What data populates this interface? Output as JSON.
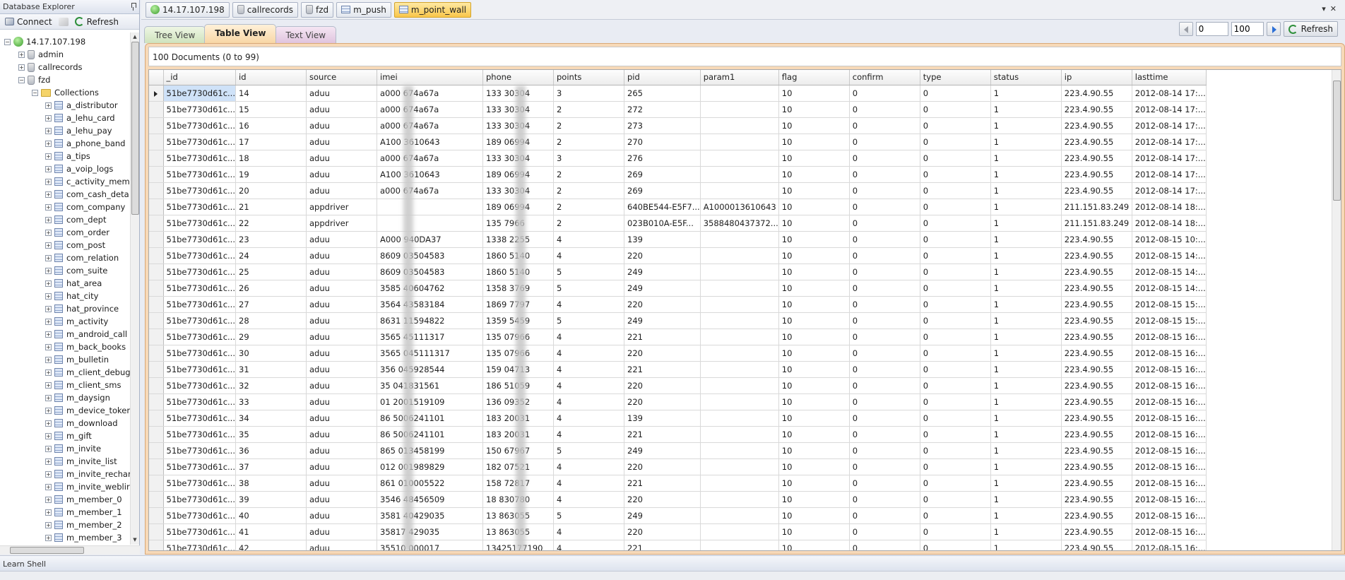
{
  "sidebar": {
    "title": "Database Explorer",
    "connect_label": "Connect",
    "refresh_label": "Refresh",
    "server": "14.17.107.198",
    "databases": [
      "admin",
      "callrecords",
      "fzd"
    ],
    "collections_label": "Collections",
    "collections": [
      "a_distributor",
      "a_lehu_card",
      "a_lehu_pay",
      "a_phone_band",
      "a_tips",
      "a_voip_logs",
      "c_activity_mem",
      "com_cash_deta",
      "com_company",
      "com_dept",
      "com_order",
      "com_post",
      "com_relation",
      "com_suite",
      "hat_area",
      "hat_city",
      "hat_province",
      "m_activity",
      "m_android_call",
      "m_back_books",
      "m_bulletin",
      "m_client_debug",
      "m_client_sms",
      "m_daysign",
      "m_device_toker",
      "m_download",
      "m_gift",
      "m_invite",
      "m_invite_list",
      "m_invite_rechar",
      "m_invite_weblir",
      "m_member_0",
      "m_member_1",
      "m_member_2",
      "m_member_3"
    ]
  },
  "doc_tabs": [
    "14.17.107.198",
    "callrecords",
    "fzd",
    "m_push",
    "m_point_wall"
  ],
  "view_tabs": [
    "Tree View",
    "Table View",
    "Text View"
  ],
  "pager": {
    "from": "0",
    "to": "100",
    "refresh_label": "Refresh"
  },
  "doc_count": "100 Documents (0 to 99)",
  "columns": [
    "_id",
    "id",
    "source",
    "imei",
    "phone",
    "points",
    "pid",
    "param1",
    "flag",
    "confirm",
    "type",
    "status",
    "ip",
    "lasttime"
  ],
  "rows": [
    [
      "51be7730d61c...",
      "14",
      "aduu",
      "a000    674a67a",
      "133    30304",
      "3",
      "265",
      "",
      "10",
      "0",
      "0",
      "1",
      "223.4.90.55",
      "2012-08-14 17:..."
    ],
    [
      "51be7730d61c...",
      "15",
      "aduu",
      "a000    674a67a",
      "133    30304",
      "2",
      "272",
      "",
      "10",
      "0",
      "0",
      "1",
      "223.4.90.55",
      "2012-08-14 17:..."
    ],
    [
      "51be7730d61c...",
      "16",
      "aduu",
      "a000    674a67a",
      "133    30304",
      "2",
      "273",
      "",
      "10",
      "0",
      "0",
      "1",
      "223.4.90.55",
      "2012-08-14 17:..."
    ],
    [
      "51be7730d61c...",
      "17",
      "aduu",
      "A100    3610643",
      "189    06994",
      "2",
      "270",
      "",
      "10",
      "0",
      "0",
      "1",
      "223.4.90.55",
      "2012-08-14 17:..."
    ],
    [
      "51be7730d61c...",
      "18",
      "aduu",
      "a000    674a67a",
      "133    30304",
      "3",
      "276",
      "",
      "10",
      "0",
      "0",
      "1",
      "223.4.90.55",
      "2012-08-14 17:..."
    ],
    [
      "51be7730d61c...",
      "19",
      "aduu",
      "A100    3610643",
      "189    06994",
      "2",
      "269",
      "",
      "10",
      "0",
      "0",
      "1",
      "223.4.90.55",
      "2012-08-14 17:..."
    ],
    [
      "51be7730d61c...",
      "20",
      "aduu",
      "a000    674a67a",
      "133    30304",
      "2",
      "269",
      "",
      "10",
      "0",
      "0",
      "1",
      "223.4.90.55",
      "2012-08-14 17:..."
    ],
    [
      "51be7730d61c...",
      "21",
      "appdriver",
      "",
      "189    06994",
      "2",
      "640BE544-E5F7...",
      "A1000013610643",
      "10",
      "0",
      "0",
      "1",
      "211.151.83.249",
      "2012-08-14 18:..."
    ],
    [
      "51be7730d61c...",
      "22",
      "appdriver",
      "",
      "135    7966",
      "2",
      "023B010A-E5F...",
      "3588480437372...",
      "10",
      "0",
      "0",
      "1",
      "211.151.83.249",
      "2012-08-14 18:..."
    ],
    [
      "51be7730d61c...",
      "23",
      "aduu",
      "A000    940DA37",
      "1338    2255",
      "4",
      "139",
      "",
      "10",
      "0",
      "0",
      "1",
      "223.4.90.55",
      "2012-08-15 10:..."
    ],
    [
      "51be7730d61c...",
      "24",
      "aduu",
      "8609    03504583",
      "1860    5140",
      "4",
      "220",
      "",
      "10",
      "0",
      "0",
      "1",
      "223.4.90.55",
      "2012-08-15 14:..."
    ],
    [
      "51be7730d61c...",
      "25",
      "aduu",
      "8609    03504583",
      "1860    5140",
      "5",
      "249",
      "",
      "10",
      "0",
      "0",
      "1",
      "223.4.90.55",
      "2012-08-15 14:..."
    ],
    [
      "51be7730d61c...",
      "26",
      "aduu",
      "3585    40604762",
      "1358    3769",
      "5",
      "249",
      "",
      "10",
      "0",
      "0",
      "1",
      "223.4.90.55",
      "2012-08-15 14:..."
    ],
    [
      "51be7730d61c...",
      "27",
      "aduu",
      "3564    43583184",
      "1869    7797",
      "4",
      "220",
      "",
      "10",
      "0",
      "0",
      "1",
      "223.4.90.55",
      "2012-08-15 15:..."
    ],
    [
      "51be7730d61c...",
      "28",
      "aduu",
      "8631    11594822",
      "1359    5459",
      "5",
      "249",
      "",
      "10",
      "0",
      "0",
      "1",
      "223.4.90.55",
      "2012-08-15 15:..."
    ],
    [
      "51be7730d61c...",
      "29",
      "aduu",
      "3565    45111317",
      "135    07966",
      "4",
      "221",
      "",
      "10",
      "0",
      "0",
      "1",
      "223.4.90.55",
      "2012-08-15 16:..."
    ],
    [
      "51be7730d61c...",
      "30",
      "aduu",
      "3565    045111317",
      "135    07966",
      "4",
      "220",
      "",
      "10",
      "0",
      "0",
      "1",
      "223.4.90.55",
      "2012-08-15 16:..."
    ],
    [
      "51be7730d61c...",
      "31",
      "aduu",
      "356    045928544",
      "159    04713",
      "4",
      "221",
      "",
      "10",
      "0",
      "0",
      "1",
      "223.4.90.55",
      "2012-08-15 16:..."
    ],
    [
      "51be7730d61c...",
      "32",
      "aduu",
      "35    041831561",
      "186    51059",
      "4",
      "220",
      "",
      "10",
      "0",
      "0",
      "1",
      "223.4.90.55",
      "2012-08-15 16:..."
    ],
    [
      "51be7730d61c...",
      "33",
      "aduu",
      "01    2001519109",
      "136    09352",
      "4",
      "220",
      "",
      "10",
      "0",
      "0",
      "1",
      "223.4.90.55",
      "2012-08-15 16:..."
    ],
    [
      "51be7730d61c...",
      "34",
      "aduu",
      "86    5006241101",
      "183    20031",
      "4",
      "139",
      "",
      "10",
      "0",
      "0",
      "1",
      "223.4.90.55",
      "2012-08-15 16:..."
    ],
    [
      "51be7730d61c...",
      "35",
      "aduu",
      "86    5006241101",
      "183    20031",
      "4",
      "221",
      "",
      "10",
      "0",
      "0",
      "1",
      "223.4.90.55",
      "2012-08-15 16:..."
    ],
    [
      "51be7730d61c...",
      "36",
      "aduu",
      "865    013458199",
      "150    67967",
      "5",
      "249",
      "",
      "10",
      "0",
      "0",
      "1",
      "223.4.90.55",
      "2012-08-15 16:..."
    ],
    [
      "51be7730d61c...",
      "37",
      "aduu",
      "012    001989829",
      "182    07521",
      "4",
      "220",
      "",
      "10",
      "0",
      "0",
      "1",
      "223.4.90.55",
      "2012-08-15 16:..."
    ],
    [
      "51be7730d61c...",
      "38",
      "aduu",
      "861    010005522",
      "158    72817",
      "4",
      "221",
      "",
      "10",
      "0",
      "0",
      "1",
      "223.4.90.55",
      "2012-08-15 16:..."
    ],
    [
      "51be7730d61c...",
      "39",
      "aduu",
      "3546    48456509",
      "18    830780",
      "4",
      "220",
      "",
      "10",
      "0",
      "0",
      "1",
      "223.4.90.55",
      "2012-08-15 16:..."
    ],
    [
      "51be7730d61c...",
      "40",
      "aduu",
      "3581    40429035",
      "13    863055",
      "5",
      "249",
      "",
      "10",
      "0",
      "0",
      "1",
      "223.4.90.55",
      "2012-08-15 16:..."
    ],
    [
      "51be7730d61c...",
      "41",
      "aduu",
      "35817    429035",
      "13    863055",
      "4",
      "220",
      "",
      "10",
      "0",
      "0",
      "1",
      "223.4.90.55",
      "2012-08-15 16:..."
    ],
    [
      "51be7730d61c...",
      "42",
      "aduu",
      "35510    000017",
      "13425177190",
      "4",
      "221",
      "",
      "10",
      "0",
      "0",
      "1",
      "223.4.90.55",
      "2012-08-15 16:..."
    ]
  ],
  "bottom": {
    "title": "Learn Shell"
  }
}
